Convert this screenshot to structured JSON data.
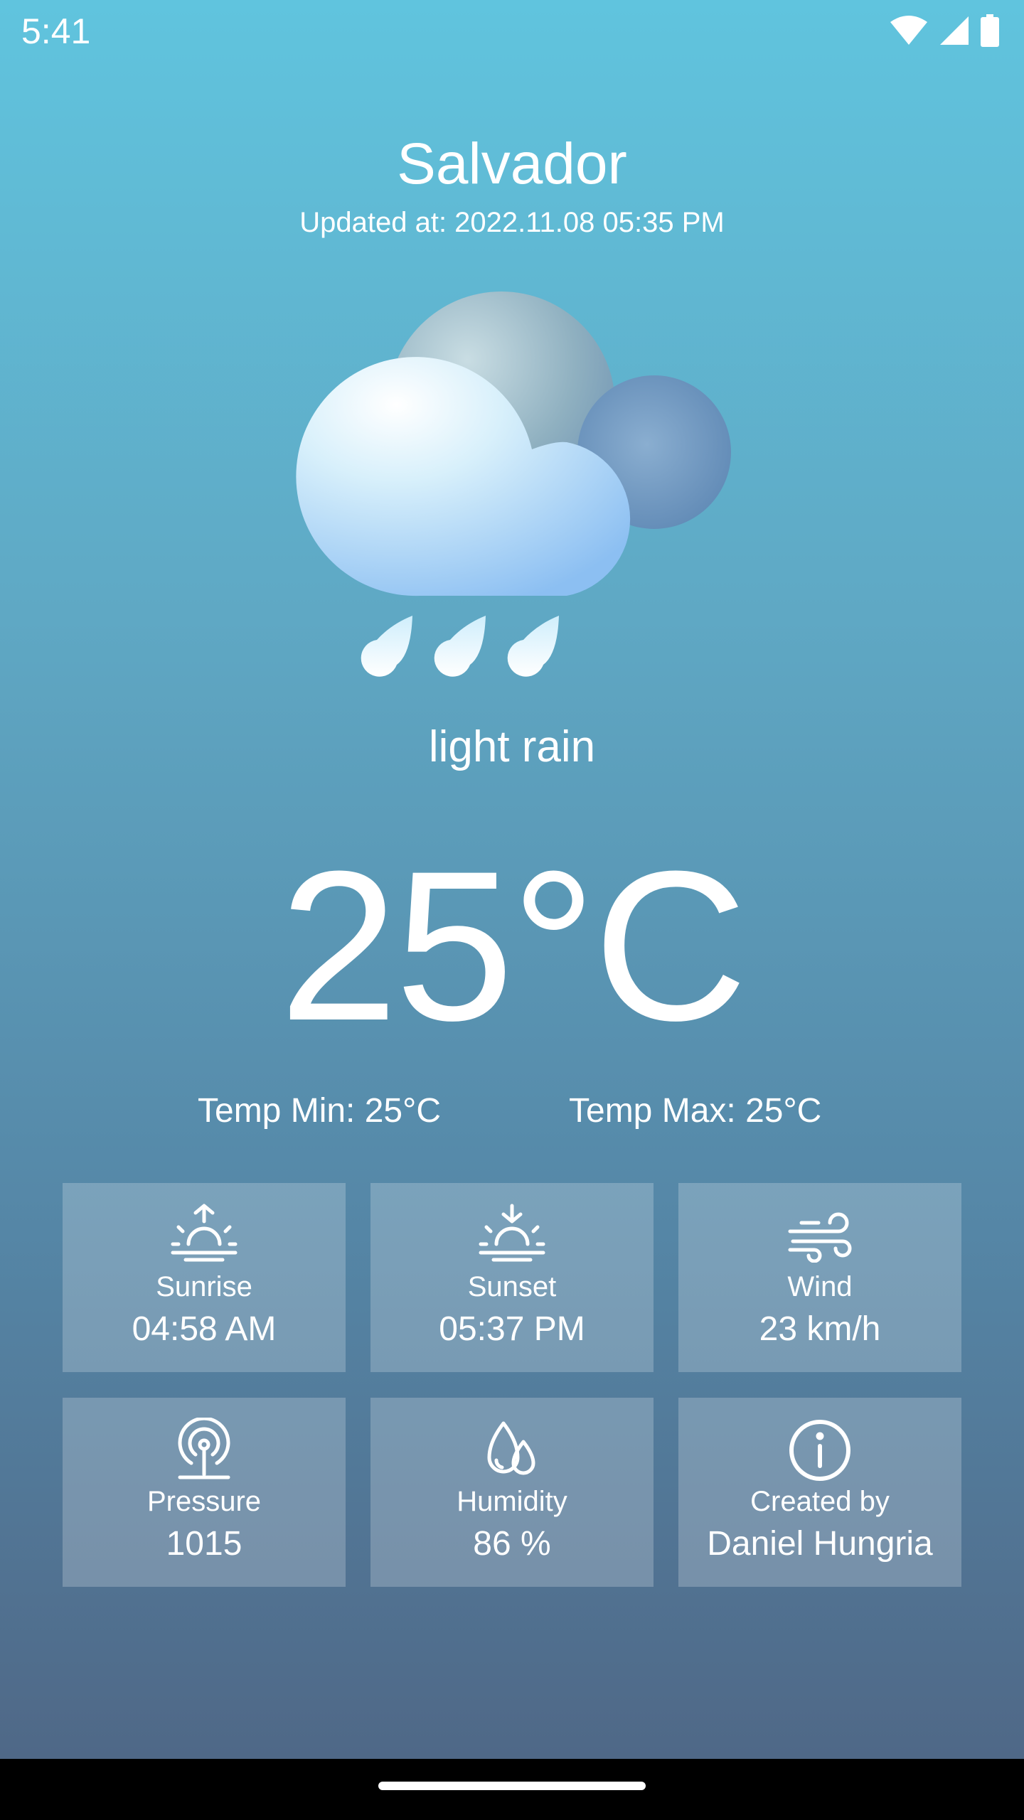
{
  "status_bar": {
    "time": "5:41"
  },
  "location": {
    "city": "Salvador",
    "updated": "Updated at: 2022.11.08 05:35 PM"
  },
  "weather": {
    "icon": "cloud-rain-icon",
    "description": "light rain",
    "temperature": "25°C",
    "temp_min": "Temp Min: 25°C",
    "temp_max": "Temp Max: 25°C"
  },
  "details": [
    {
      "icon": "sunrise-icon",
      "label": "Sunrise",
      "value": "04:58 AM"
    },
    {
      "icon": "sunset-icon",
      "label": "Sunset",
      "value": "05:37 PM"
    },
    {
      "icon": "wind-icon",
      "label": "Wind",
      "value": "23 km/h"
    },
    {
      "icon": "pressure-icon",
      "label": "Pressure",
      "value": "1015"
    },
    {
      "icon": "humidity-icon",
      "label": "Humidity",
      "value": "86 %"
    },
    {
      "icon": "info-icon",
      "label": "Created by",
      "value": "Daniel Hungria"
    }
  ],
  "colors": {
    "gradient_top": "#60c4de",
    "gradient_bottom": "#4f6887",
    "tile_background": "rgba(255,255,255,0.22)",
    "text": "#ffffff"
  }
}
